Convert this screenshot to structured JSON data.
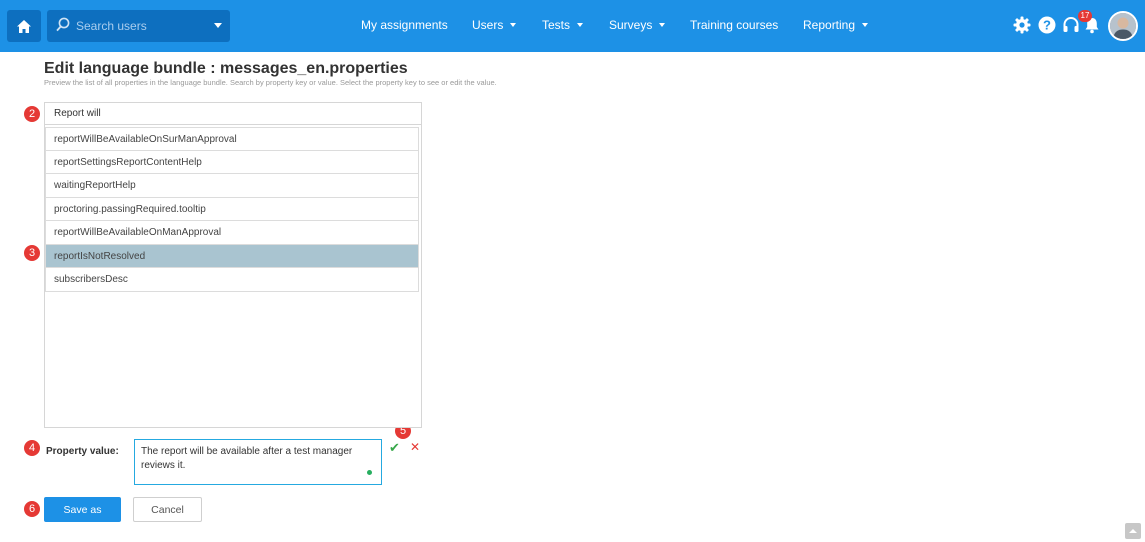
{
  "topbar": {
    "home_icon": "home-icon",
    "search_placeholder": "Search users",
    "nav": [
      {
        "label": "My assignments",
        "has_dropdown": false
      },
      {
        "label": "Users",
        "has_dropdown": true
      },
      {
        "label": "Tests",
        "has_dropdown": true
      },
      {
        "label": "Surveys",
        "has_dropdown": true
      },
      {
        "label": "Training courses",
        "has_dropdown": false
      },
      {
        "label": "Reporting",
        "has_dropdown": true
      }
    ],
    "icons": [
      "gear-icon",
      "help-icon",
      "headset-icon",
      "notification-bell-icon"
    ],
    "notification_count": "17",
    "bar_color": "#1d91e6"
  },
  "page": {
    "title": "Edit language bundle : messages_en.properties",
    "description": "Preview the list of all properties in the language bundle. Search by property key or value. Select the property key to see or edit the value."
  },
  "steps": [
    "2",
    "3",
    "4",
    "5",
    "6"
  ],
  "filter": {
    "value": "Report will"
  },
  "properties": [
    {
      "key": "reportWillBeAvailableOnSurManApproval",
      "selected": false
    },
    {
      "key": "reportSettingsReportContentHelp",
      "selected": false
    },
    {
      "key": "waitingReportHelp",
      "selected": false
    },
    {
      "key": "proctoring.passingRequired.tooltip",
      "selected": false
    },
    {
      "key": "reportWillBeAvailableOnManApproval",
      "selected": false
    },
    {
      "key": "reportIsNotResolved",
      "selected": true
    },
    {
      "key": "subscribersDesc",
      "selected": false
    }
  ],
  "property_value": {
    "label": "Property value:",
    "value": "The report will be available after a test manager reviews it.",
    "confirm_symbol": "✔",
    "cancel_symbol": "✕"
  },
  "actions": {
    "save_label": "Save as",
    "cancel_label": "Cancel"
  },
  "colors": {
    "accent": "#1d91e6",
    "step_marker": "#e53935",
    "selected_row": "#a9c4d0"
  }
}
